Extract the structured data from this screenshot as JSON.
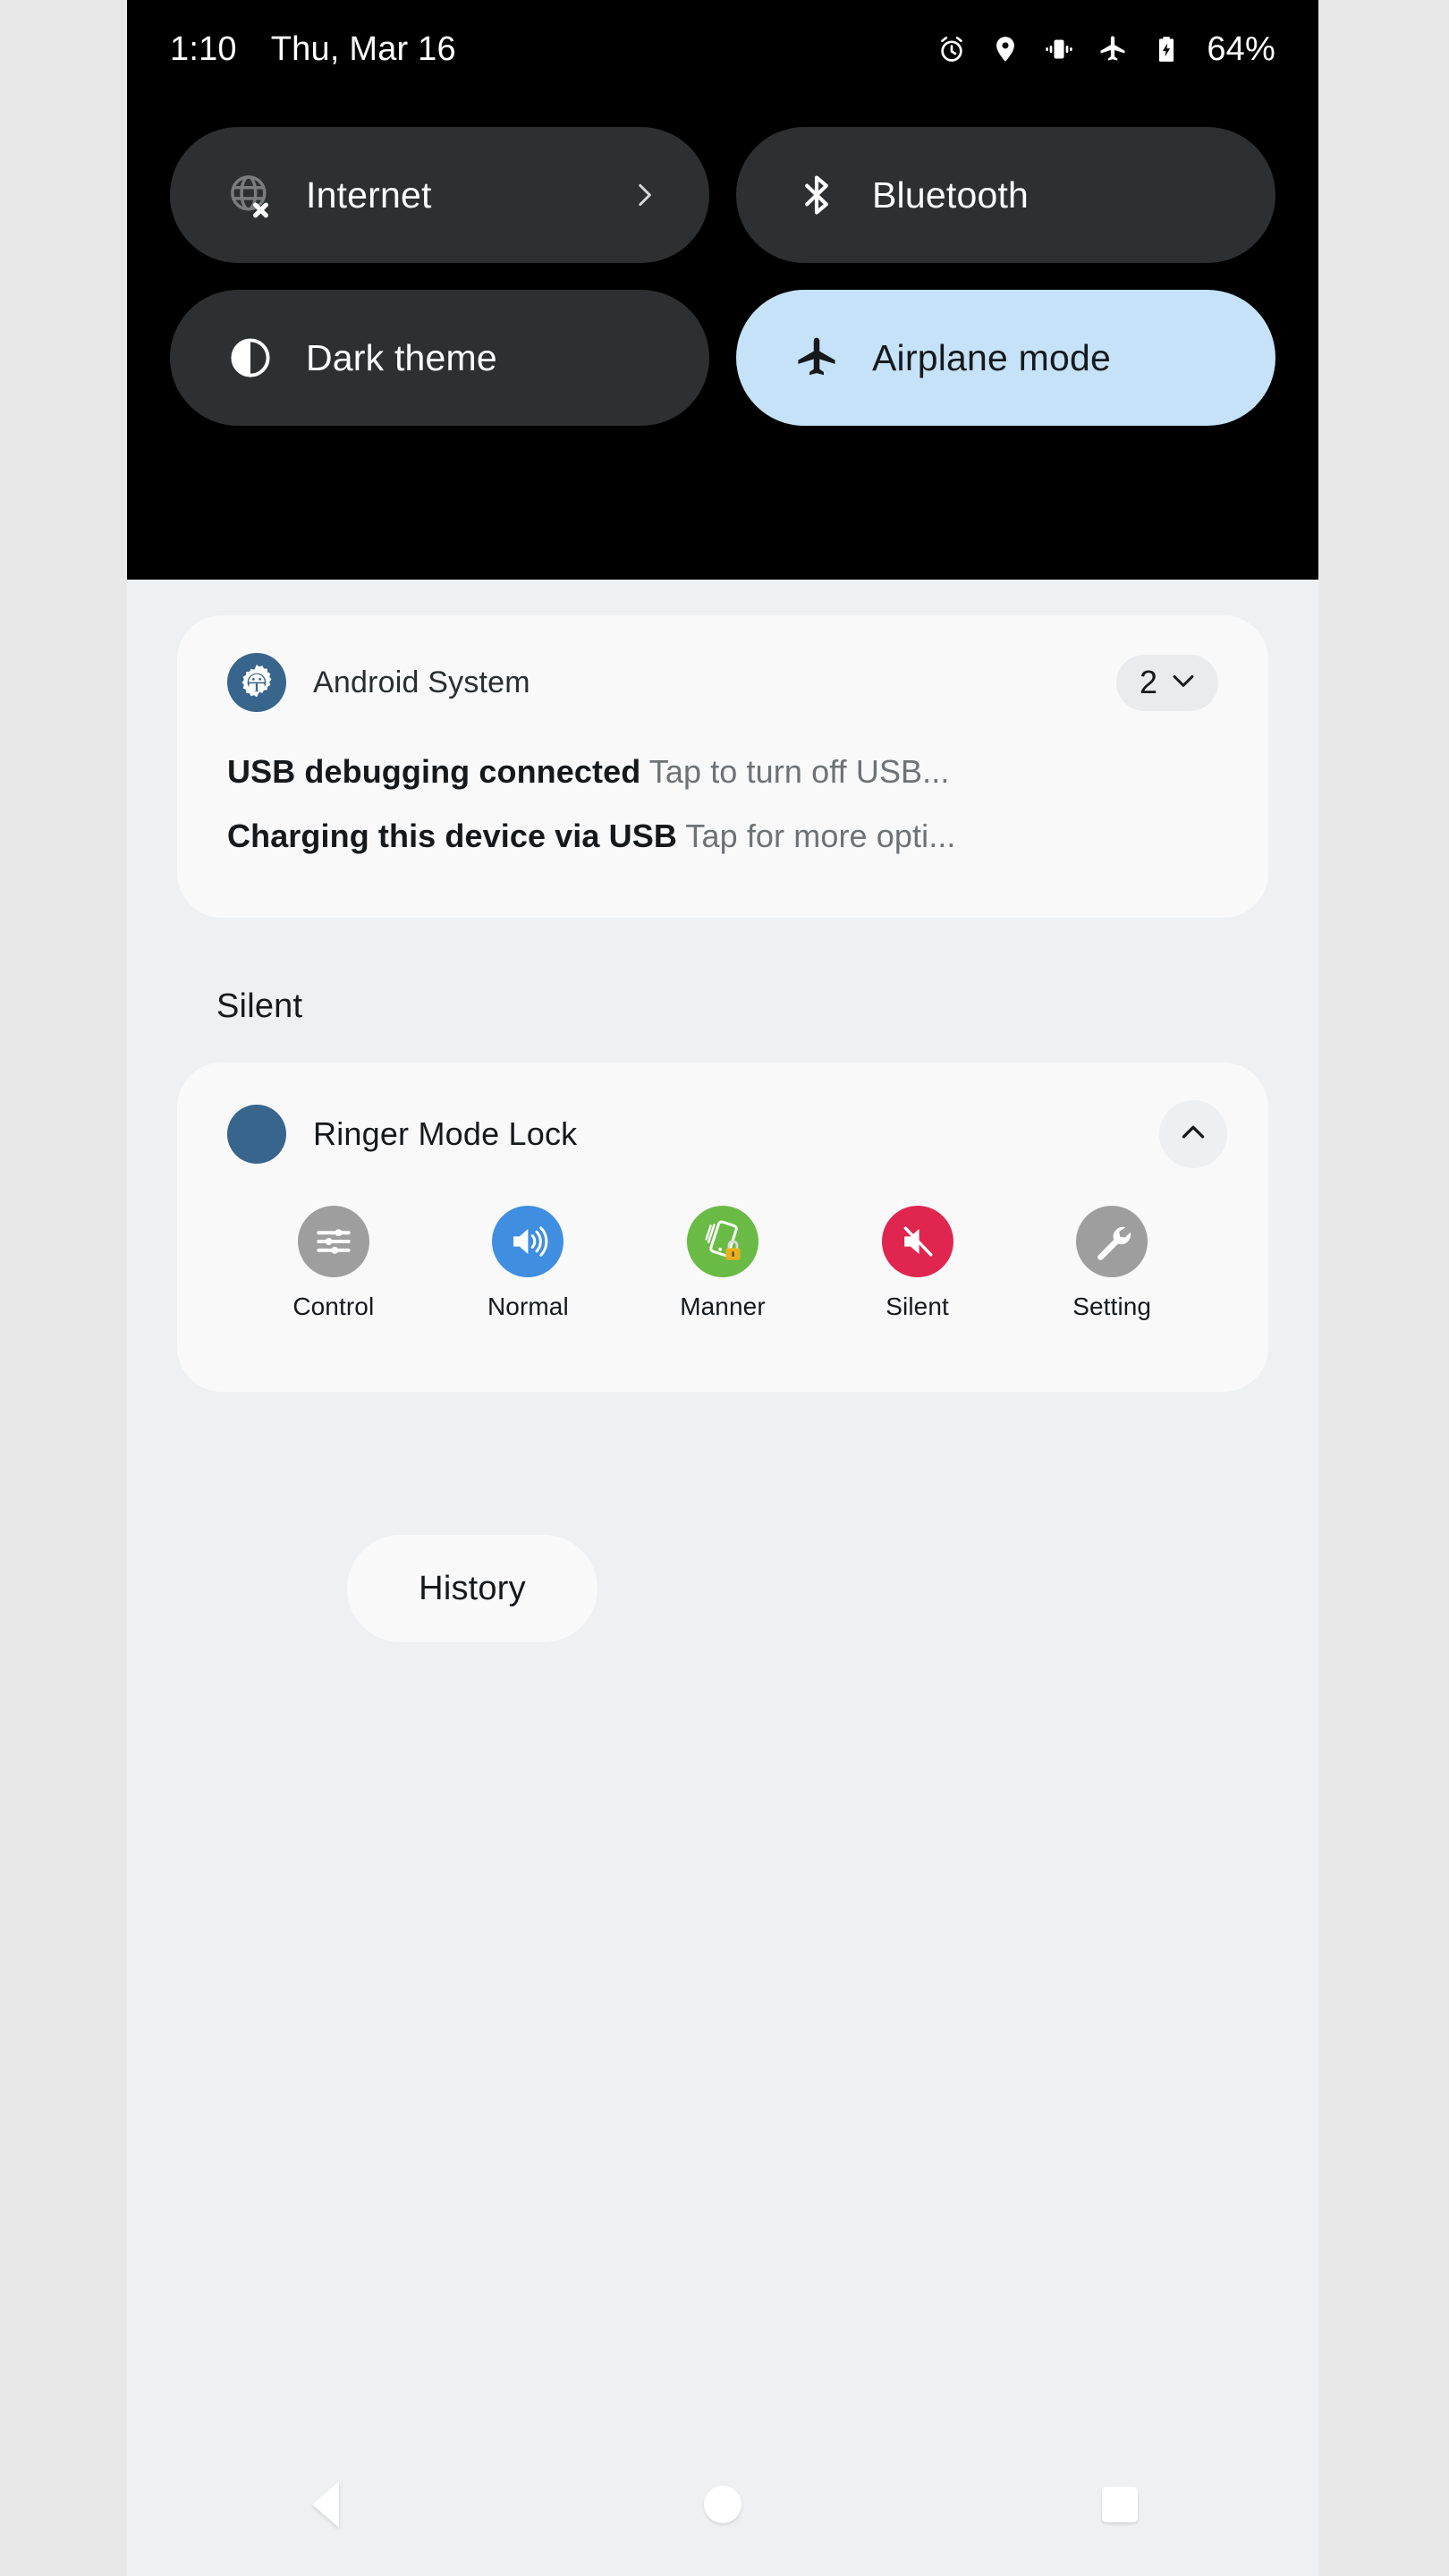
{
  "status_bar": {
    "time": "1:10",
    "date": "Thu, Mar 16",
    "battery_percent": "64%",
    "icons": [
      "alarm-icon",
      "location-icon",
      "vibrate-icon",
      "airplane-icon",
      "battery-charging-icon"
    ]
  },
  "quick_settings": {
    "tiles": [
      {
        "label": "Internet",
        "icon": "globe-off-icon",
        "active": false,
        "has_chevron": true
      },
      {
        "label": "Bluetooth",
        "icon": "bluetooth-icon",
        "active": false,
        "has_chevron": false
      },
      {
        "label": "Dark theme",
        "icon": "contrast-circle-icon",
        "active": false,
        "has_chevron": false
      },
      {
        "label": "Airplane mode",
        "icon": "airplane-icon",
        "active": true,
        "has_chevron": false
      }
    ],
    "active_tile_color": "#c5e2f8",
    "inactive_tile_color": "#2e2f30"
  },
  "notifications": {
    "group": {
      "app_name": "Android System",
      "app_icon": "android-system-gear-icon",
      "count": "2",
      "expand_icon": "chevron-down-icon",
      "lines": [
        {
          "title": "USB debugging connected",
          "text": "Tap to turn off USB..."
        },
        {
          "title": "Charging this device via USB",
          "text": "Tap for more opti..."
        }
      ]
    },
    "section_label": "Silent",
    "ringer": {
      "title": "Ringer Mode Lock",
      "icon_color": "#38658c",
      "collapse_icon": "chevron-up-icon",
      "actions": [
        {
          "label": "Control",
          "icon": "sliders-icon",
          "color": "#9e9e9e"
        },
        {
          "label": "Normal",
          "icon": "volume-up-icon",
          "color": "#3f8ee0"
        },
        {
          "label": "Manner",
          "icon": "phone-vibrate-lock-icon",
          "color": "#69bb45"
        },
        {
          "label": "Silent",
          "icon": "volume-mute-icon",
          "color": "#e0264f"
        },
        {
          "label": "Setting",
          "icon": "wrench-icon",
          "color": "#9e9e9e"
        }
      ]
    },
    "history_label": "History"
  },
  "nav_bar": {
    "back": "back-icon",
    "home": "home-icon",
    "recents": "recents-icon"
  }
}
